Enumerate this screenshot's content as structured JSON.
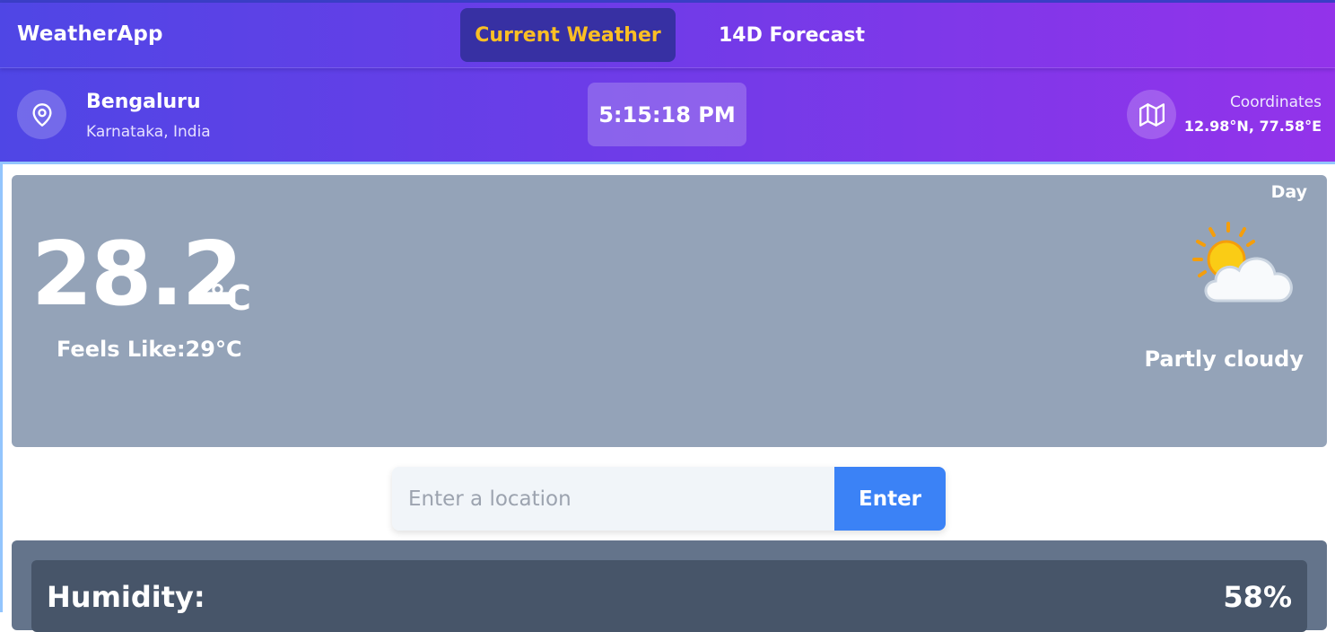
{
  "app": {
    "brand": "WeatherApp"
  },
  "nav": {
    "tabs": [
      {
        "label": "Current Weather",
        "active": true
      },
      {
        "label": "14D Forecast",
        "active": false
      }
    ]
  },
  "location": {
    "city": "Bengaluru",
    "region": "Karnataka, India",
    "time": "5:15:18 PM",
    "coordinates_label": "Coordinates",
    "coordinates_value": "12.98°N, 77.58°E",
    "icons": [
      "map-pin-icon",
      "map-icon"
    ]
  },
  "current": {
    "period": "Day",
    "temperature": "28.2",
    "unit": "°C",
    "feels_like": "Feels Like:29°C",
    "condition": "Partly cloudy",
    "condition_icon": "partly-cloudy-icon"
  },
  "search": {
    "placeholder": "Enter a location",
    "value": "",
    "button_label": "Enter"
  },
  "details": {
    "rows": [
      {
        "label": "Humidity:",
        "value": "58%"
      }
    ]
  },
  "colors": {
    "gradient_start": "#4f46e5",
    "gradient_end": "#9333ea",
    "active_tab_bg": "#3730a3",
    "active_tab_text": "#fbbf24",
    "weather_card_bg": "#94a3b8",
    "details_card_bg": "#64748b",
    "detail_row_bg": "#475569",
    "button_bg": "#3b82f6"
  }
}
